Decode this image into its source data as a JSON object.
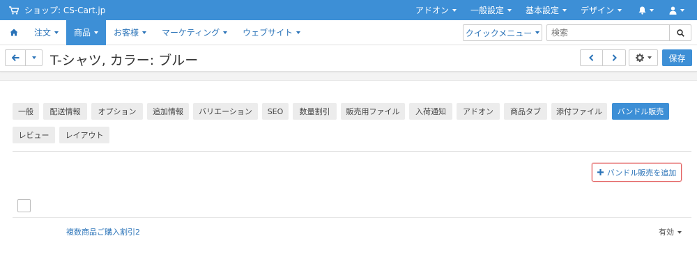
{
  "topbar": {
    "store_label": "ショップ: CS-Cart.jp",
    "menus": [
      "アドオン",
      "一般設定",
      "基本設定",
      "デザイン"
    ]
  },
  "nav": {
    "items": [
      "注文",
      "商品",
      "お客様",
      "マーケティング",
      "ウェブサイト"
    ],
    "active": "商品",
    "quick_menu": "クイックメニュー",
    "search_placeholder": "検索"
  },
  "titlebar": {
    "title": "T-シャツ, カラー: ブルー",
    "save": "保存"
  },
  "tabs": [
    "一般",
    "配送情報",
    "オプション",
    "追加情報",
    "バリエーション",
    "SEO",
    "数量割引",
    "販売用ファイル",
    "入荷通知",
    "アドオン",
    "商品タブ",
    "添付ファイル",
    "バンドル販売",
    "レビュー",
    "レイアウト"
  ],
  "active_tab": "バンドル販売",
  "content": {
    "add_button": "バンドル販売を追加",
    "bundles": [
      {
        "name": "複数商品ご購入割引2",
        "status": "有効"
      }
    ]
  },
  "colors": {
    "primary": "#3d8fd6",
    "link": "#2a73b8",
    "highlight_border": "#e35d5d"
  }
}
